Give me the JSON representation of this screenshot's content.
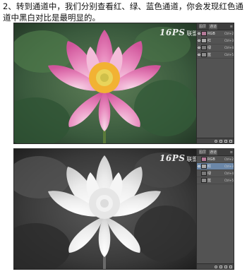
{
  "instruction": {
    "text": "2、转到通道中，我们分别查看红、绿、蓝色通道，你会发现红色通道中黑白对比是最明显的。"
  },
  "screenshots": [
    {
      "mode": "color",
      "watermark": {
        "logo": "16PS",
        "text": "联盟原创"
      },
      "panel": {
        "tabs": [
          "图层",
          "通道"
        ],
        "active_tab": "通道",
        "channels": [
          {
            "name": "RGB",
            "shortcut": "Ctrl+2",
            "visible": true,
            "selected": false
          },
          {
            "name": "红",
            "shortcut": "Ctrl+3",
            "visible": true,
            "selected": true
          },
          {
            "name": "绿",
            "shortcut": "Ctrl+4",
            "visible": true,
            "selected": false
          },
          {
            "name": "蓝",
            "shortcut": "Ctrl+5",
            "visible": true,
            "selected": false
          }
        ]
      }
    },
    {
      "mode": "grayscale",
      "watermark": {
        "logo": "16PS",
        "text": "联盟原创"
      },
      "panel": {
        "tabs": [
          "图层",
          "通道"
        ],
        "active_tab": "通道",
        "channels": [
          {
            "name": "RGB",
            "shortcut": "Ctrl+2",
            "visible": false,
            "selected": false
          },
          {
            "name": "红",
            "shortcut": "Ctrl+3",
            "visible": true,
            "selected": true
          },
          {
            "name": "绿",
            "shortcut": "Ctrl+4",
            "visible": false,
            "selected": false
          },
          {
            "name": "蓝",
            "shortcut": "Ctrl+5",
            "visible": false,
            "selected": false
          }
        ]
      }
    }
  ],
  "colors": {
    "petal_pink": "#e07fb5",
    "petal_light": "#f6c9e0",
    "stamen": "#f2b233",
    "leaf_green": "#3f6b45",
    "panel_bg": "#535353",
    "selected_row": "#6b87a8"
  }
}
